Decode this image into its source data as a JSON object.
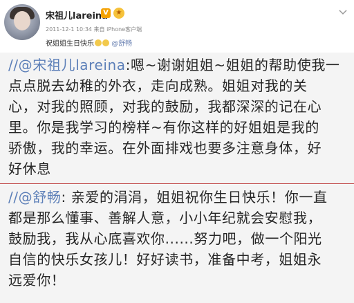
{
  "post": {
    "user_name": "宋祖儿lareina",
    "vip_badge": "V",
    "medal_icon": "medal-icon",
    "meta": "2011-12-1 10:34 来自 iPhone客户端",
    "text_prefix": "祝姐姐生日快乐",
    "mention": "@舒畅"
  },
  "comments": [
    {
      "mention": "//@宋祖儿lareina",
      "lines": [
        ":嗯~谢谢姐姐~姐姐的帮助使我一",
        "点点脱去幼稚的外衣，走向成熟。姐姐对我的关",
        "心，对我的照顾，对我的鼓励，我都深深的记在心",
        "里。你是我学习的榜样~有你这样的好姐姐是我的",
        "骄傲，我的幸运。在外面排戏也要多注意身体，好",
        "好休息"
      ]
    },
    {
      "mention": "//@舒畅",
      "lines": [
        ": 亲爱的涓涓，姐姐祝你生日快乐！你一直",
        "都是那么懂事、善解人意，小小年纪就会安慰我，",
        "鼓励我，我从心底喜欢你......努力吧，做一个阳光",
        "自信的快乐女孩儿！好好读书，准备中考，姐姐永",
        "远爱你！"
      ]
    }
  ],
  "colors": {
    "mention": "#5c7fb8",
    "divider": "#c24a4a",
    "comment_bg": "#f4f4f4",
    "vip": "#f4a100"
  }
}
